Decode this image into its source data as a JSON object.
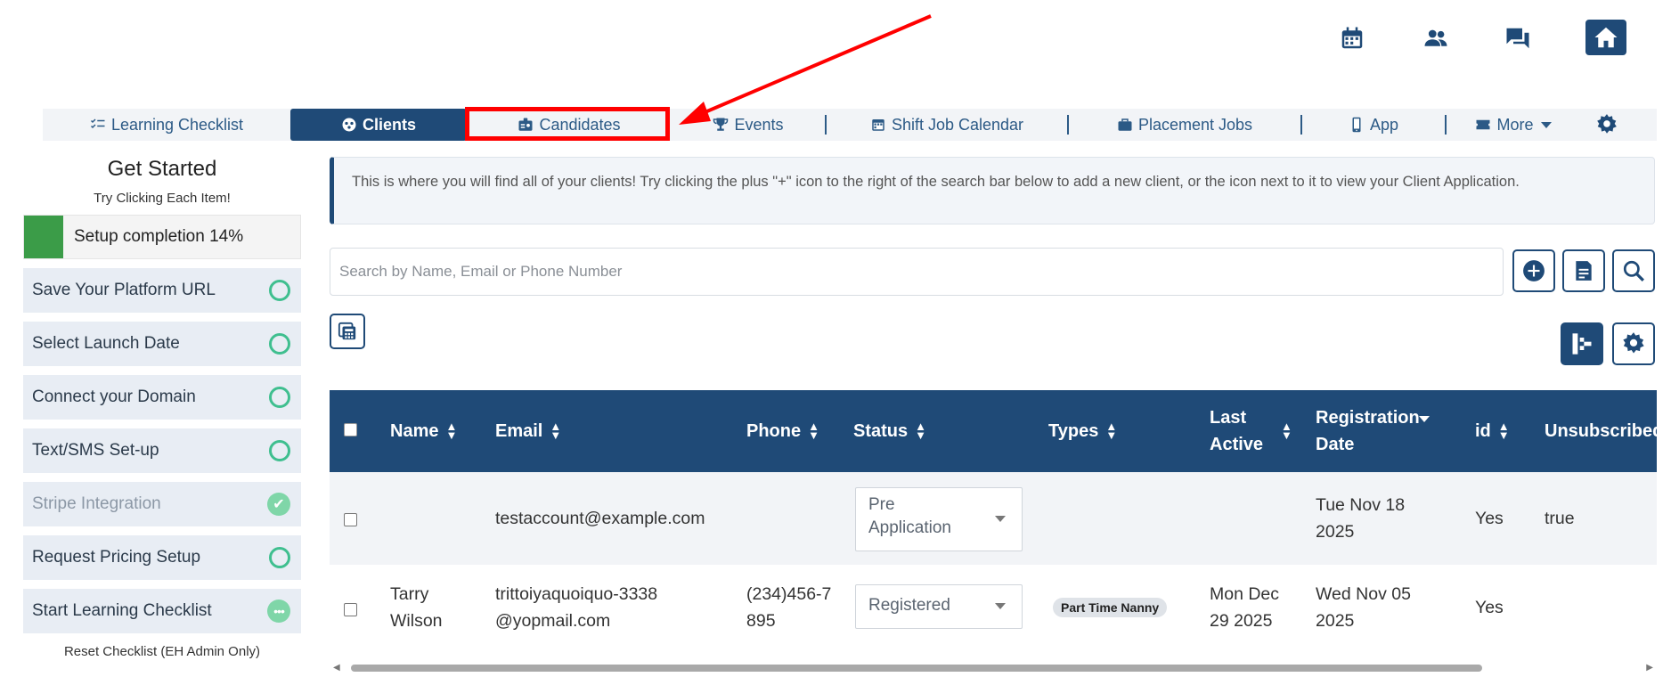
{
  "top_icons": [
    "calendar-icon",
    "people-icon",
    "chat-icon",
    "home-icon"
  ],
  "nav": {
    "items": [
      {
        "label": "Learning Checklist",
        "icon": "checklist-icon"
      },
      {
        "label": "Clients",
        "icon": "clients-icon"
      },
      {
        "label": "Candidates",
        "icon": "badge-icon"
      },
      {
        "label": "Events",
        "icon": "trophy-icon"
      },
      {
        "label": "Shift Job Calendar",
        "icon": "calendar-icon"
      },
      {
        "label": "Placement Jobs",
        "icon": "briefcase-icon"
      },
      {
        "label": "App",
        "icon": "phone-icon"
      },
      {
        "label": "More",
        "icon": "ticket-icon"
      }
    ],
    "active": "Clients"
  },
  "left": {
    "title": "Get Started",
    "subtitle": "Try Clicking Each Item!",
    "progress_label": "Setup completion 14%",
    "progress_fraction": 0.14,
    "items": [
      {
        "label": "Save Your Platform URL",
        "state": "todo"
      },
      {
        "label": "Select Launch Date",
        "state": "todo"
      },
      {
        "label": "Connect your Domain",
        "state": "todo"
      },
      {
        "label": "Text/SMS Set-up",
        "state": "todo"
      },
      {
        "label": "Stripe Integration",
        "state": "done"
      },
      {
        "label": "Request Pricing Setup",
        "state": "todo"
      },
      {
        "label": "Start Learning Checklist",
        "state": "in-progress"
      }
    ],
    "reset": "Reset Checklist (EH Admin Only)"
  },
  "info_text": "This is where you will find all of your clients! Try clicking the plus \"+\" icon to the right of the search bar below to add a new client, or the icon next to it to view your Client Application.",
  "search": {
    "placeholder": "Search by Name, Email or Phone Number"
  },
  "table": {
    "headers": {
      "name": "Name",
      "email": "Email",
      "phone": "Phone",
      "status": "Status",
      "types": "Types",
      "last_active": "Last Active",
      "registration": "Registration Date",
      "id": "id",
      "unsubscribed": "Unsubscribed"
    },
    "rows": [
      {
        "name": "",
        "email": "testaccount@example.com",
        "phone": "",
        "status": "Pre Application",
        "types": "",
        "last_active": "",
        "registration": "Tue Nov 18 2025",
        "id": "Yes",
        "unsubscribed": "true"
      },
      {
        "name": "Tarry Wilson",
        "email": "trittoiyaquoiquo-3338@yopmail.com",
        "phone": "(234)456-7895",
        "status": "Registered",
        "types": "Part Time Nanny",
        "last_active": "Mon Dec 29 2025",
        "registration": "Wed Nov 05 2025",
        "id": "Yes",
        "unsubscribed": ""
      }
    ]
  },
  "colors": {
    "primary": "#1f4a77",
    "progress": "#3b9c48",
    "check": "#3fbf8f",
    "annotation": "#ff0000"
  }
}
